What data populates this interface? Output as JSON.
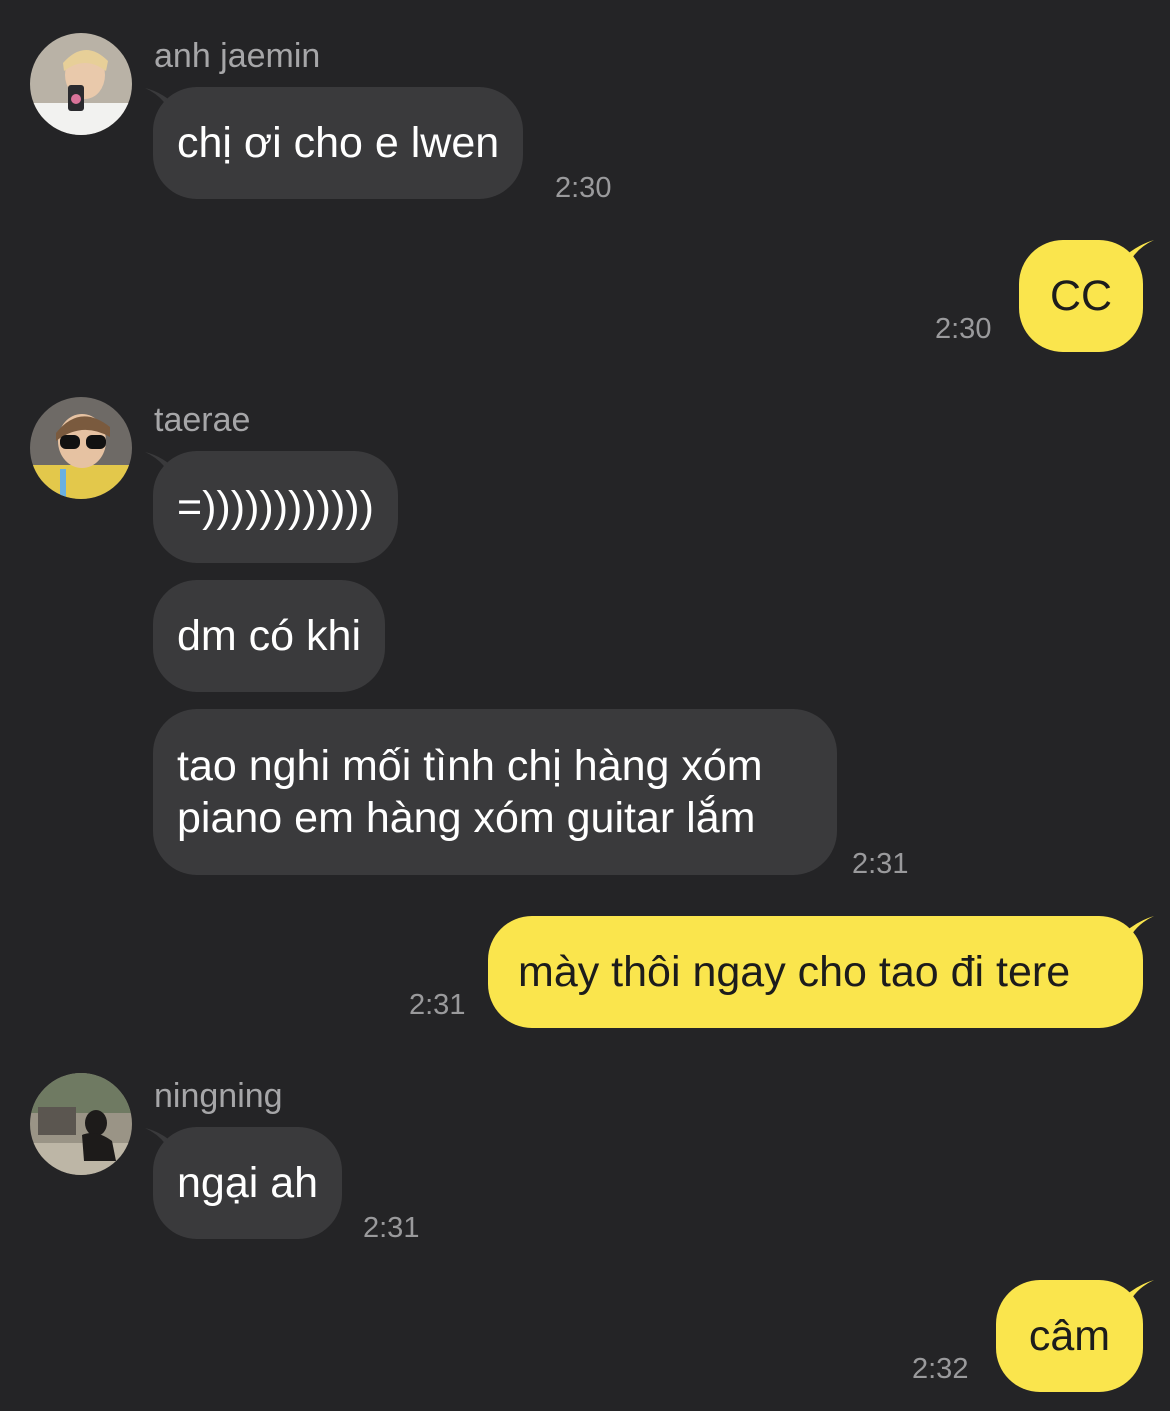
{
  "colors": {
    "background": "#242426",
    "incoming_bubble": "#3a3a3c",
    "outgoing_bubble": "#fae54d",
    "incoming_text": "#ffffff",
    "outgoing_text": "#1c1c1c",
    "meta_text": "#9a9a9c"
  },
  "messages": {
    "m1": {
      "sender": "anh jaemin",
      "text": "chị ơi cho e lwen",
      "time": "2:30"
    },
    "m2": {
      "text": "CC",
      "time": "2:30"
    },
    "m3": {
      "sender": "taerae",
      "text": "=))))))))))))"
    },
    "m4": {
      "text": "dm có khi"
    },
    "m5": {
      "text": "tao nghi mối tình chị hàng xóm piano em hàng xóm guitar lắm",
      "time": "2:31"
    },
    "m6": {
      "text": "mày thôi ngay cho tao đi tere",
      "time": "2:31"
    },
    "m7": {
      "sender": "ningning",
      "text": "ngại ah",
      "time": "2:31"
    },
    "m8": {
      "text": "câm",
      "time": "2:32"
    }
  }
}
